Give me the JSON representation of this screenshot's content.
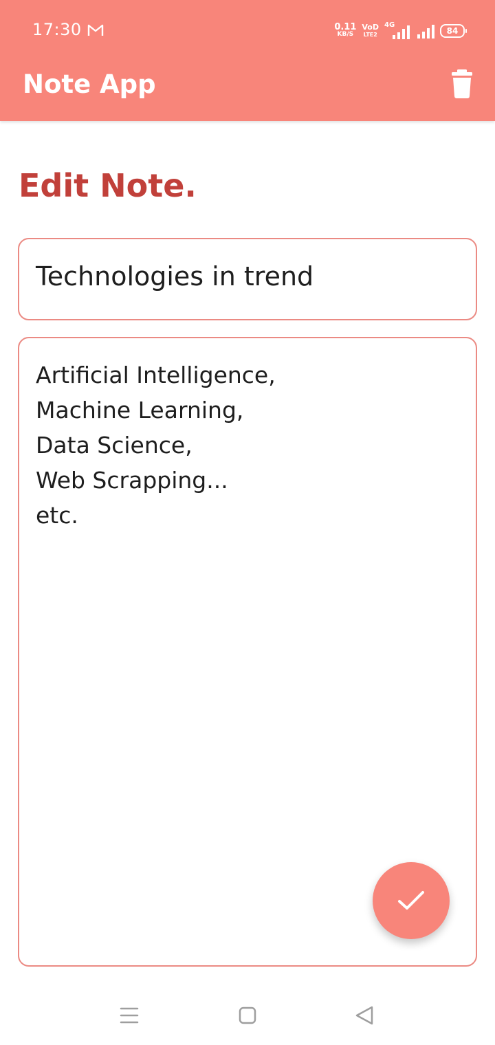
{
  "status_bar": {
    "time": "17:30",
    "speed_value": "0.11",
    "speed_unit": "KB/S",
    "volte_top": "VoD",
    "volte_bottom": "LTE2",
    "network_label": "4G",
    "battery": "84",
    "notification_icon": "gmail-icon"
  },
  "app_bar": {
    "title": "Note App",
    "delete_icon": "trash-icon"
  },
  "page": {
    "heading": "Edit Note."
  },
  "note": {
    "title_value": "Technologies in trend",
    "content_lines": [
      "Artificial Intelligence,",
      "Machine Learning,",
      "Data Science,",
      "Web Scrapping...",
      "etc."
    ]
  },
  "fab": {
    "icon": "check-icon"
  },
  "nav_bar": {
    "buttons": [
      "menu-icon",
      "home-icon",
      "back-icon"
    ]
  },
  "colors": {
    "primary": "#f8857a",
    "heading": "#c1403a",
    "border": "#eb8a83",
    "text": "#1e1e1e"
  }
}
